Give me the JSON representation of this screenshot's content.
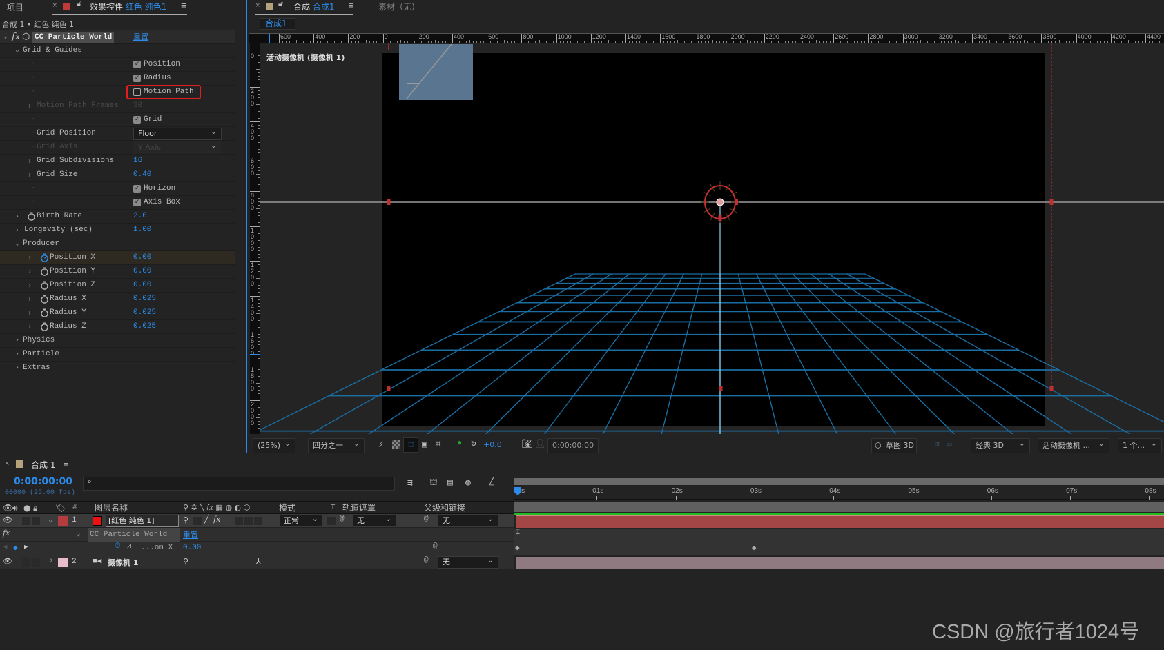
{
  "left_panel": {
    "project_tab": "项目",
    "effect_tab_prefix": "效果控件",
    "effect_tab_layer": "红色 纯色1",
    "breadcrumb": "合成 1 • 红色 纯色 1",
    "effect_name": "CC Particle World",
    "reset_label": "重置",
    "rows": [
      {
        "type": "group",
        "level": 1,
        "label": "Grid & Guides",
        "expanded": true
      },
      {
        "type": "checkbox",
        "label": "Position",
        "checked": true
      },
      {
        "type": "checkbox",
        "label": "Radius",
        "checked": true
      },
      {
        "type": "checkbox",
        "label": "Motion Path",
        "checked": false,
        "highlight": true
      },
      {
        "type": "prop",
        "level": 2,
        "label": "Motion Path Frames",
        "value": "30",
        "disabled": true,
        "twirl": true
      },
      {
        "type": "checkbox",
        "label": "Grid",
        "checked": true
      },
      {
        "type": "dropdown",
        "label": "Grid Position",
        "value": "Floor"
      },
      {
        "type": "dropdown",
        "label": "Grid Axis",
        "value": "Y Axis",
        "disabled": true
      },
      {
        "type": "prop",
        "level": 2,
        "label": "Grid Subdivisions",
        "value": "16",
        "twirl": true
      },
      {
        "type": "prop",
        "level": 2,
        "label": "Grid Size",
        "value": "0.40",
        "twirl": true
      },
      {
        "type": "checkbox",
        "label": "Horizon",
        "checked": true
      },
      {
        "type": "checkbox",
        "label": "Axis Box",
        "checked": true
      },
      {
        "type": "prop",
        "level": 1,
        "label": "Birth Rate",
        "value": "2.0",
        "twirl": true,
        "stopwatch": true
      },
      {
        "type": "prop",
        "level": 1,
        "label": "Longevity (sec)",
        "value": "1.00",
        "twirl": true
      },
      {
        "type": "group",
        "level": 1,
        "label": "Producer",
        "expanded": true
      },
      {
        "type": "prop",
        "level": 2,
        "label": "Position X",
        "value": "0.00",
        "twirl": true,
        "stopwatch": true,
        "active": true
      },
      {
        "type": "prop",
        "level": 2,
        "label": "Position Y",
        "value": "0.00",
        "twirl": true,
        "stopwatch": true
      },
      {
        "type": "prop",
        "level": 2,
        "label": "Position Z",
        "value": "0.00",
        "twirl": true,
        "stopwatch": true
      },
      {
        "type": "prop",
        "level": 2,
        "label": "Radius X",
        "value": "0.025",
        "twirl": true,
        "stopwatch": true
      },
      {
        "type": "prop",
        "level": 2,
        "label": "Radius Y",
        "value": "0.025",
        "twirl": true,
        "stopwatch": true
      },
      {
        "type": "prop",
        "level": 2,
        "label": "Radius Z",
        "value": "0.025",
        "twirl": true,
        "stopwatch": true
      },
      {
        "type": "group",
        "level": 1,
        "label": "Physics",
        "expanded": false
      },
      {
        "type": "group",
        "level": 1,
        "label": "Particle",
        "expanded": false
      },
      {
        "type": "group",
        "level": 1,
        "label": "Extras",
        "expanded": false
      }
    ]
  },
  "viewer": {
    "comp_tab_prefix": "合成",
    "comp_tab_name": "合成1",
    "footage_tab": "素材（无）",
    "comp_subtab": "合成1",
    "camera_label": "活动摄像机 (摄像机 1)",
    "ruler_top": [
      "600",
      "400",
      "200",
      "0",
      "200",
      "400",
      "600",
      "800",
      "1000",
      "1200",
      "1400",
      "1600",
      "1800",
      "2000",
      "2200",
      "2400",
      "2600",
      "2800",
      "3000",
      "3200",
      "3400",
      "3600",
      "3800",
      "4000",
      "4200",
      "4400"
    ],
    "ruler_left": [
      "0",
      "200",
      "400",
      "600",
      "800",
      "1000",
      "1200",
      "1400",
      "1600",
      "1800",
      "2000"
    ],
    "toolbar": {
      "zoom": "(25%)",
      "resolution": "四分之一",
      "exposure": "+0.0",
      "timecode": "0:00:00:00",
      "draft3d": "草图 3D",
      "renderer": "经典 3D",
      "view": "活动摄像机 ...",
      "views": "1 个..."
    },
    "colors": {
      "grid": "#1a6ea3",
      "axis": "#c03030",
      "horizon": "#9a9a9a"
    }
  },
  "timeline": {
    "tab": "合成 1",
    "timecode": "0:00:00:00",
    "fps": "00000 (25.00 fps)",
    "search_placeholder": "",
    "headers": {
      "layer_name": "图层名称",
      "mode": "模式",
      "t": "T",
      "track_matte": "轨道遮罩",
      "parent": "父级和链接",
      "num": "#"
    },
    "layers": [
      {
        "index": "1",
        "name": "[红色 纯色 1]",
        "mode": "正常",
        "matte": "无",
        "parent": "无",
        "label_color": "#b43c3c"
      },
      {
        "index": "2",
        "name": "摄像机 1",
        "parent": "无",
        "label_color": "#e8bcc8"
      }
    ],
    "effect_row": {
      "name": "CC Particle World",
      "reset": "重置"
    },
    "property_row": {
      "name": "...on X",
      "value": "0.00"
    },
    "time_labels": [
      "00s",
      "01s",
      "02s",
      "03s",
      "04s",
      "05s",
      "06s",
      "07s",
      "08s"
    ],
    "keyframes_sec": [
      0,
      3
    ]
  },
  "watermark": "CSDN @旅行者1024号"
}
